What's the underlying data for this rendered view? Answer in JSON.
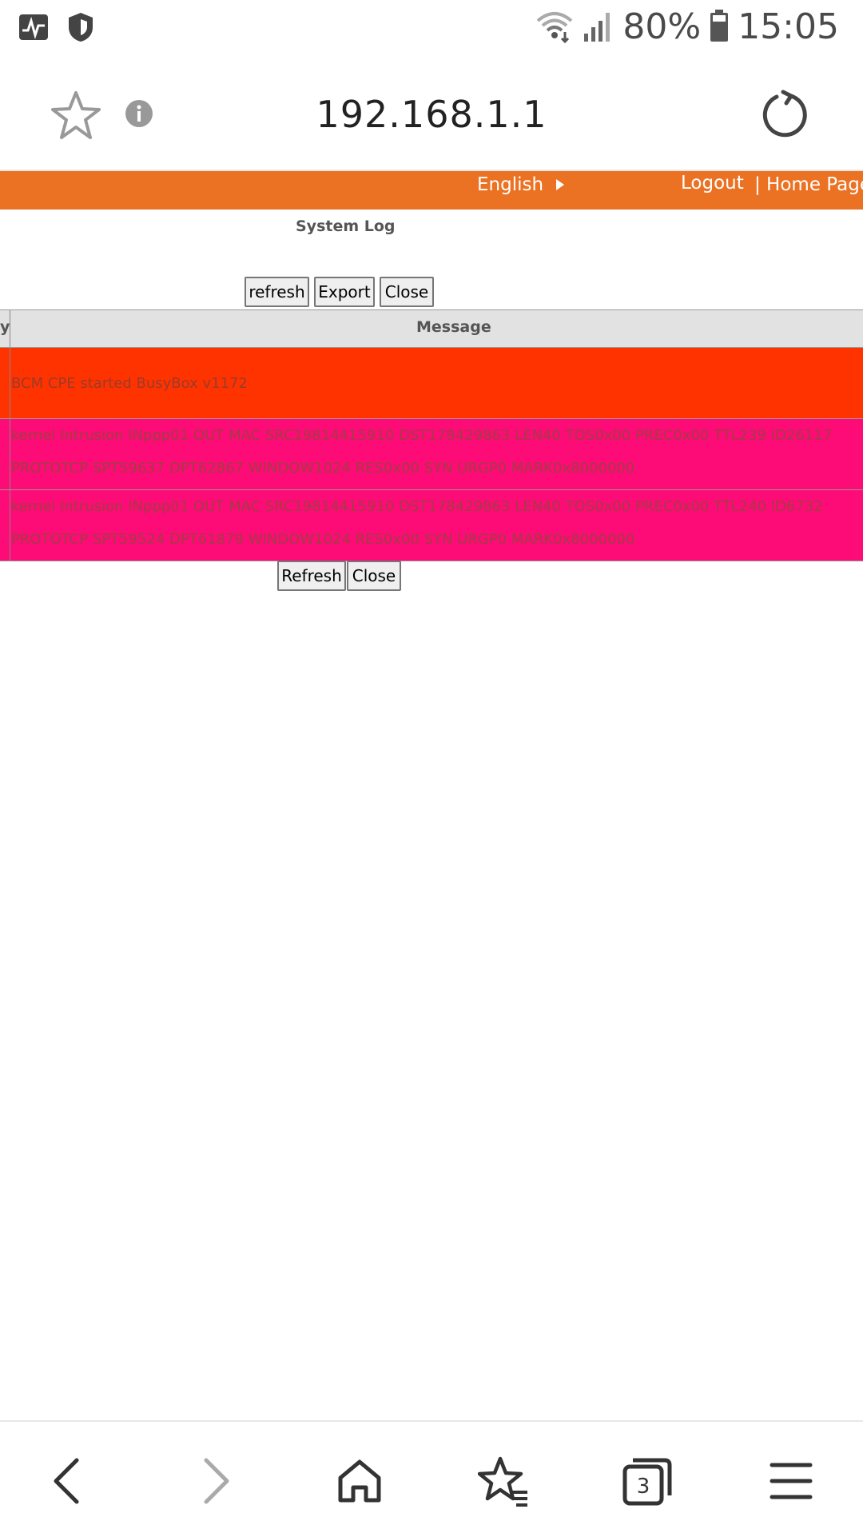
{
  "status_bar": {
    "battery": "80%",
    "time": "15:05",
    "icons": [
      "pulse-icon",
      "shield-icon",
      "wifi-icon",
      "signal-icon",
      "battery-icon"
    ]
  },
  "browser": {
    "url": "192.168.1.1",
    "icons": [
      "star-icon",
      "info-icon",
      "reload-icon"
    ]
  },
  "header": {
    "language": "English",
    "logout": "Logout",
    "home_page": "| Home Page"
  },
  "page": {
    "title": "System Log",
    "top_buttons": {
      "refresh": "refresh",
      "export": "Export",
      "close": "Close"
    },
    "bottom_buttons": {
      "refresh": "Refresh",
      "close": "Close"
    }
  },
  "log_table": {
    "columns": [
      "y",
      "Message"
    ],
    "rows": [
      {
        "message": "BCM CPE started BusyBox v1172",
        "color": "#fe3300"
      },
      {
        "message_line1": "kernel Intrusion INppp01 OUT MAC SRC19814415910 DST178429863 LEN40 TOS0x00 PREC0x00 TTL239 ID26117",
        "message_line2": "PROTOTCP SPT59637 DPT62867 WINDOW1024 RES0x00 SYN URGP0 MARK0x8000000",
        "color": "#fd0b76"
      },
      {
        "message_line1": "kernel Intrusion INppp01 OUT MAC SRC19814415910 DST178429863 LEN40 TOS0x00 PREC0x00 TTL240 ID6732",
        "message_line2": "PROTOTCP SPT59524 DPT61879 WINDOW1024 RES0x00 SYN URGP0 MARK0x8000000",
        "color": "#fd0b76"
      }
    ]
  },
  "bottom_nav": {
    "tab_count": "3",
    "icons": [
      "back-icon",
      "forward-icon",
      "home-icon",
      "bookmarks-icon",
      "tabs-icon",
      "menu-icon"
    ]
  },
  "colors": {
    "accent_orange": "#ec7223",
    "row_red": "#fe3300",
    "row_pink": "#fd0b76"
  }
}
